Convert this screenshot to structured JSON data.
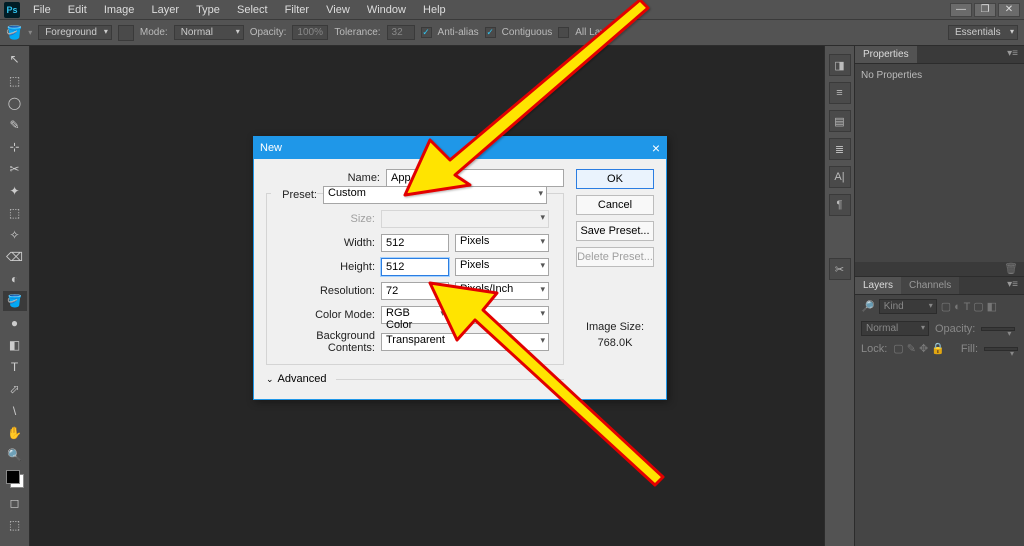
{
  "app": {
    "name": "Ps"
  },
  "menu": [
    "File",
    "Edit",
    "Image",
    "Layer",
    "Type",
    "Select",
    "Filter",
    "View",
    "Window",
    "Help"
  ],
  "options": {
    "tool_icon": "🪣",
    "fg_label": "Foreground",
    "mode_label": "Mode:",
    "mode_value": "Normal",
    "opacity_label": "Opacity:",
    "opacity_value": "100%",
    "tolerance_label": "Tolerance:",
    "tolerance_value": "32",
    "antialias": "Anti-alias",
    "contiguous": "Contiguous",
    "alllayers": "All Layers",
    "workspace": "Essentials"
  },
  "tools": [
    "↖",
    "⬚",
    "◯",
    "✎",
    "⊹",
    "✂",
    "✦",
    "⬚",
    "✧",
    "⌫",
    "◐",
    "🪣",
    "●",
    "◧",
    "T",
    "⬀",
    "\\",
    "✋",
    "🔍"
  ],
  "dock_icons": [
    "◨",
    "≡",
    "▤",
    "≣",
    "A|",
    "¶",
    "",
    "✂"
  ],
  "panels": {
    "properties": {
      "tab": "Properties",
      "body": "No Properties"
    },
    "layers": {
      "tab1": "Layers",
      "tab2": "Channels",
      "kind": "Kind",
      "blend": "Normal",
      "opacity_lbl": "Opacity:",
      "lock_lbl": "Lock:",
      "fill_lbl": "Fill:"
    }
  },
  "dialog": {
    "title": "New",
    "name_lbl": "Name:",
    "name_val": "App icon",
    "preset_lbl": "Preset:",
    "preset_val": "Custom",
    "size_lbl": "Size:",
    "width_lbl": "Width:",
    "width_val": "512",
    "width_unit": "Pixels",
    "height_lbl": "Height:",
    "height_val": "512",
    "height_unit": "Pixels",
    "res_lbl": "Resolution:",
    "res_val": "72",
    "res_unit": "Pixels/Inch",
    "color_lbl": "Color Mode:",
    "color_val": "RGB Color",
    "bg_lbl": "Background Contents:",
    "bg_val": "Transparent",
    "advanced": "Advanced",
    "ok": "OK",
    "cancel": "Cancel",
    "save_preset": "Save Preset...",
    "delete_preset": "Delete Preset...",
    "imgsize_lbl": "Image Size:",
    "imgsize_val": "768.0K"
  }
}
